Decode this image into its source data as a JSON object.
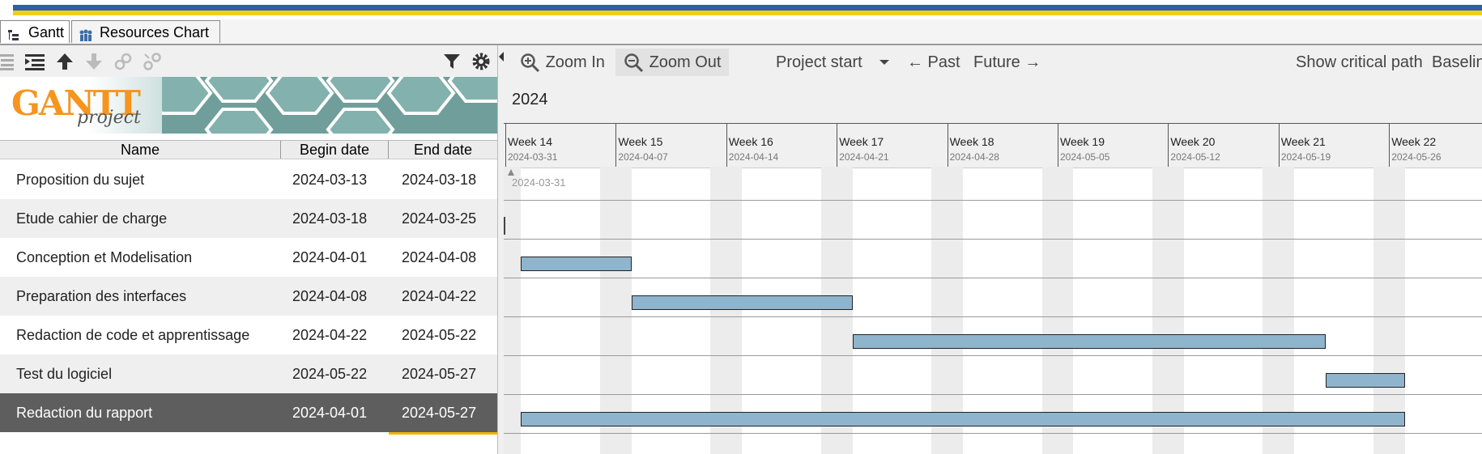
{
  "tabs": [
    {
      "label": "Gantt",
      "icon": "gantt-tree-icon",
      "active": true
    },
    {
      "label": "Resources Chart",
      "icon": "resources-people-icon",
      "active": false
    }
  ],
  "toolbar": {
    "icons": [
      "outdent-icon",
      "indent-icon",
      "move-up-icon",
      "move-down-icon",
      "link-icon",
      "unlink-icon",
      "filter-icon",
      "gear-icon"
    ]
  },
  "logo": {
    "main": "GANTT",
    "sub": "project"
  },
  "table": {
    "columns": [
      "Name",
      "Begin date",
      "End date"
    ],
    "rows": [
      {
        "name": "Proposition du sujet",
        "begin": "2024-03-13",
        "end": "2024-03-18"
      },
      {
        "name": "Etude cahier de charge",
        "begin": "2024-03-18",
        "end": "2024-03-25"
      },
      {
        "name": "Conception et Modelisation",
        "begin": "2024-04-01",
        "end": "2024-04-08"
      },
      {
        "name": "Preparation des interfaces",
        "begin": "2024-04-08",
        "end": "2024-04-22"
      },
      {
        "name": "Redaction de code et apprentissage",
        "begin": "2024-04-22",
        "end": "2024-05-22"
      },
      {
        "name": "Test du logiciel",
        "begin": "2024-05-22",
        "end": "2024-05-27"
      },
      {
        "name": "Redaction du rapport",
        "begin": "2024-04-01",
        "end": "2024-05-27"
      }
    ],
    "selected_row": 6
  },
  "chart_toolbar": {
    "zoom_in": "Zoom In",
    "zoom_out": "Zoom Out",
    "project_start": "Project start",
    "past": "← Past",
    "future": "Future →",
    "critical_path": "Show critical path",
    "baseline": "Baselin"
  },
  "timeline": {
    "year": "2024",
    "start_marker": "2024-03-31",
    "weeks": [
      {
        "label": "Week 14",
        "date": "2024-03-31"
      },
      {
        "label": "Week 15",
        "date": "2024-04-07"
      },
      {
        "label": "Week 16",
        "date": "2024-04-14"
      },
      {
        "label": "Week 17",
        "date": "2024-04-21"
      },
      {
        "label": "Week 18",
        "date": "2024-04-28"
      },
      {
        "label": "Week 19",
        "date": "2024-05-05"
      },
      {
        "label": "Week 20",
        "date": "2024-05-12"
      },
      {
        "label": "Week 21",
        "date": "2024-05-19"
      },
      {
        "label": "Week 22",
        "date": "2024-05-26"
      }
    ]
  },
  "colors": {
    "bar_fill": "#8fb4cd",
    "selected_row": "#5e5e5e",
    "banner_top_blue": "#2f5fa7",
    "banner_top_yellow": "#f0cf16",
    "logo_orange": "#f7941d",
    "selection_underline": "#f0b400"
  }
}
